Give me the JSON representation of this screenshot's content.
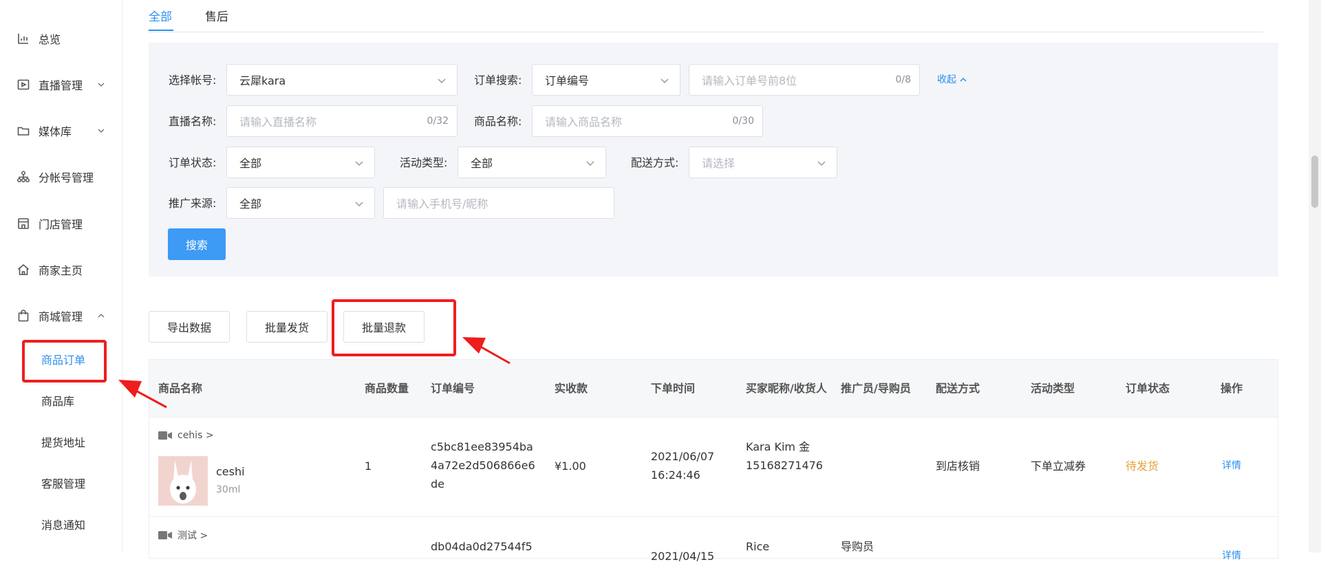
{
  "sidebar": {
    "items": [
      {
        "label": "总览",
        "icon": "chart-icon"
      },
      {
        "label": "直播管理",
        "icon": "video-icon"
      },
      {
        "label": "媒体库",
        "icon": "folder-icon"
      },
      {
        "label": "分帐号管理",
        "icon": "hierarchy-icon"
      },
      {
        "label": "门店管理",
        "icon": "store-icon"
      },
      {
        "label": "商家主页",
        "icon": "home-icon"
      },
      {
        "label": "商城管理",
        "icon": "bag-icon"
      }
    ],
    "subitems": [
      "商品订单",
      "商品库",
      "提货地址",
      "客服管理",
      "消息通知"
    ]
  },
  "tabs": [
    "全部",
    "售后"
  ],
  "filters": {
    "account_label": "选择帐号:",
    "account_value": "云犀kara",
    "order_search_label": "订单搜索:",
    "order_search_type": "订单编号",
    "order_no_placeholder": "请输入订单号前8位",
    "order_no_count": "0/8",
    "collapse_label": "收起",
    "live_name_label": "直播名称:",
    "live_name_placeholder": "请输入直播名称",
    "live_name_count": "0/32",
    "product_name_label": "商品名称:",
    "product_name_placeholder": "请输入商品名称",
    "product_name_count": "0/30",
    "order_status_label": "订单状态:",
    "order_status_value": "全部",
    "activity_type_label": "活动类型:",
    "activity_type_value": "全部",
    "delivery_label": "配送方式:",
    "delivery_placeholder": "请选择",
    "source_label": "推广来源:",
    "source_value": "全部",
    "phone_placeholder": "请输入手机号/昵称",
    "search_button": "搜索"
  },
  "actions": [
    "导出数据",
    "批量发货",
    "批量退款"
  ],
  "table": {
    "headers": [
      "商品名称",
      "商品数量",
      "订单编号",
      "实收款",
      "下单时间",
      "买家昵称/收货人",
      "推广员/导购员",
      "配送方式",
      "活动类型",
      "订单状态",
      "操作"
    ],
    "rows": [
      {
        "live": "cehis >",
        "product": "ceshi",
        "spec": "30ml",
        "qty": "1",
        "order_no": "c5bc81ee83954ba4a72e2d506866e6de",
        "paid": "¥1.00",
        "time": "2021/06/07 16:24:46",
        "buyer": "Kara Kim 金 15168271476",
        "promoter": "",
        "delivery": "到店核销",
        "activity": "下单立减券",
        "status": "待发货",
        "op": "详情"
      },
      {
        "live": "测试 >",
        "product": "",
        "spec": "",
        "qty": "",
        "order_no": "db04da0d27544f5",
        "paid": "",
        "time": "2021/04/15",
        "buyer": "Rice",
        "promoter": "导购员",
        "delivery": "",
        "activity": "",
        "status": "",
        "op": "详情"
      }
    ]
  }
}
